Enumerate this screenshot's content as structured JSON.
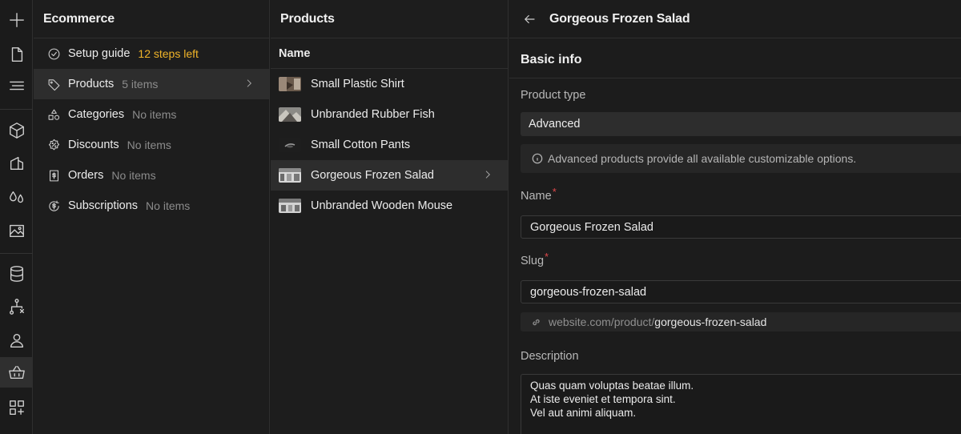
{
  "rail": {
    "items": [
      "plus-icon",
      "file-icon",
      "menu-lines-icon",
      "cube-icon",
      "shapes-icon",
      "drops-icon",
      "image-icon",
      "database-icon",
      "flow-icon",
      "user-icon",
      "basket-icon",
      "apps-icon"
    ],
    "active": "basket-icon"
  },
  "ecommerce": {
    "title": "Ecommerce",
    "items": [
      {
        "label": "Setup guide",
        "count": "12 steps left"
      },
      {
        "label": "Products",
        "count": "5 items"
      },
      {
        "label": "Categories",
        "count": "No items"
      },
      {
        "label": "Discounts",
        "count": "No items"
      },
      {
        "label": "Orders",
        "count": "No items"
      },
      {
        "label": "Subscriptions",
        "count": "No items"
      }
    ]
  },
  "products": {
    "title": "Products",
    "column_header": "Name",
    "items": [
      "Small Plastic Shirt",
      "Unbranded Rubber Fish",
      "Small Cotton Pants",
      "Gorgeous Frozen Salad",
      "Unbranded Wooden Mouse"
    ]
  },
  "detail": {
    "title": "Gorgeous Frozen Salad",
    "section": "Basic info",
    "product_type_label": "Product type",
    "product_type_value": "Advanced",
    "product_type_info": "Advanced products provide all available customizable options.",
    "name_label": "Name",
    "name_required": "*",
    "name_value": "Gorgeous Frozen Salad",
    "slug_label": "Slug",
    "slug_required": "*",
    "slug_value": "gorgeous-frozen-salad",
    "url_base": "website.com/product/",
    "url_slug": "gorgeous-frozen-salad",
    "description_label": "Description",
    "description_lines": [
      "Quas quam voluptas beatae illum.",
      "At iste eveniet et tempora sint.",
      "Vel aut animi aliquam."
    ]
  },
  "colors": {
    "accent_warning": "#f0b429",
    "required": "#e0484b",
    "background": "#1c1c1c"
  }
}
